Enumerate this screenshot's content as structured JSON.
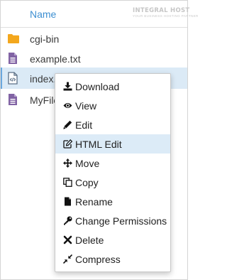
{
  "header": {
    "column_name": "Name",
    "brand_line1": "INTEGRAL HOST",
    "brand_line2": "YOUR BUSINESS HOSTING PARTNER"
  },
  "files": [
    {
      "name": "cgi-bin",
      "icon": "folder-icon",
      "selected": false
    },
    {
      "name": "example.txt",
      "icon": "text-file-icon",
      "selected": false
    },
    {
      "name": "index.html",
      "icon": "code-file-icon",
      "selected": true
    },
    {
      "name": "MyFile",
      "icon": "text-file-icon",
      "selected": false
    }
  ],
  "context_menu": {
    "items": [
      {
        "label": "Download",
        "icon": "download-icon"
      },
      {
        "label": "View",
        "icon": "eye-icon"
      },
      {
        "label": "Edit",
        "icon": "pencil-icon"
      },
      {
        "label": "HTML Edit",
        "icon": "edit-square-icon",
        "highlighted": true
      },
      {
        "label": "Move",
        "icon": "move-arrows-icon"
      },
      {
        "label": "Copy",
        "icon": "copy-icon"
      },
      {
        "label": "Rename",
        "icon": "file-icon"
      },
      {
        "label": "Change Permissions",
        "icon": "key-icon"
      },
      {
        "label": "Delete",
        "icon": "close-icon"
      },
      {
        "label": "Compress",
        "icon": "compress-icon"
      }
    ]
  },
  "colors": {
    "accent": "#3d8fd1",
    "folder": "#f3a71d",
    "file": "#8163a4",
    "highlight": "#dcebf7"
  }
}
